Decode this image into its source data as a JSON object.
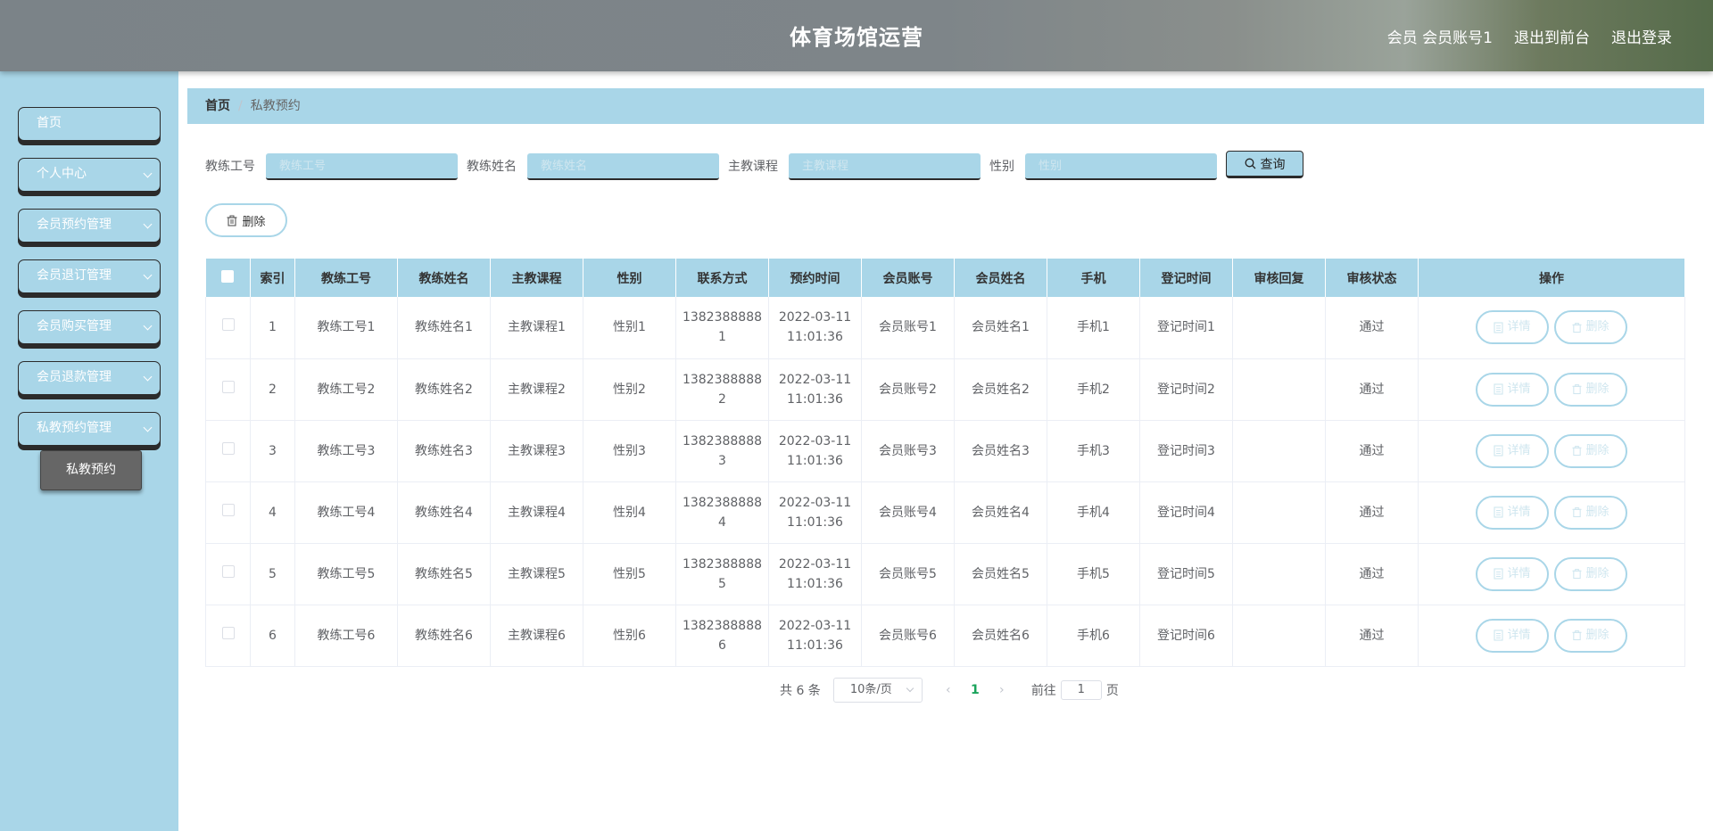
{
  "header": {
    "title": "体育场馆运营",
    "user": "会员 会员账号1",
    "front": "退出到前台",
    "logout": "退出登录"
  },
  "sidebar": {
    "items": [
      {
        "label": "首页"
      },
      {
        "label": "个人中心"
      },
      {
        "label": "会员预约管理"
      },
      {
        "label": "会员退订管理"
      },
      {
        "label": "会员购买管理"
      },
      {
        "label": "会员退款管理"
      },
      {
        "label": "私教预约管理"
      }
    ],
    "sub": "私教预约"
  },
  "breadcrumb": {
    "home": "首页",
    "sep": "/",
    "current": "私教预约"
  },
  "search": {
    "f1_label": "教练工号",
    "f1_placeholder": "教练工号",
    "f2_label": "教练姓名",
    "f2_placeholder": "教练姓名",
    "f3_label": "主教课程",
    "f3_placeholder": "主教课程",
    "f4_label": "性别",
    "f4_placeholder": "性别",
    "query": "查询"
  },
  "toolbar": {
    "delete": "删除"
  },
  "table": {
    "headers": [
      "索引",
      "教练工号",
      "教练姓名",
      "主教课程",
      "性别",
      "联系方式",
      "预约时间",
      "会员账号",
      "会员姓名",
      "手机",
      "登记时间",
      "审核回复",
      "审核状态",
      "操作"
    ],
    "detail": "详情",
    "delete": "删除",
    "rows": [
      {
        "idx": "1",
        "code": "教练工号1",
        "name": "教练姓名1",
        "course": "主教课程1",
        "gender": "性别1",
        "phone_a": "1382388888",
        "phone_b": "1",
        "date": "2022-03-11",
        "time": "11:01:36",
        "acct": "会员账号1",
        "mname": "会员姓名1",
        "mobile": "手机1",
        "reg": "登记时间1",
        "reply": "",
        "status": "通过"
      },
      {
        "idx": "2",
        "code": "教练工号2",
        "name": "教练姓名2",
        "course": "主教课程2",
        "gender": "性别2",
        "phone_a": "1382388888",
        "phone_b": "2",
        "date": "2022-03-11",
        "time": "11:01:36",
        "acct": "会员账号2",
        "mname": "会员姓名2",
        "mobile": "手机2",
        "reg": "登记时间2",
        "reply": "",
        "status": "通过"
      },
      {
        "idx": "3",
        "code": "教练工号3",
        "name": "教练姓名3",
        "course": "主教课程3",
        "gender": "性别3",
        "phone_a": "1382388888",
        "phone_b": "3",
        "date": "2022-03-11",
        "time": "11:01:36",
        "acct": "会员账号3",
        "mname": "会员姓名3",
        "mobile": "手机3",
        "reg": "登记时间3",
        "reply": "",
        "status": "通过"
      },
      {
        "idx": "4",
        "code": "教练工号4",
        "name": "教练姓名4",
        "course": "主教课程4",
        "gender": "性别4",
        "phone_a": "1382388888",
        "phone_b": "4",
        "date": "2022-03-11",
        "time": "11:01:36",
        "acct": "会员账号4",
        "mname": "会员姓名4",
        "mobile": "手机4",
        "reg": "登记时间4",
        "reply": "",
        "status": "通过"
      },
      {
        "idx": "5",
        "code": "教练工号5",
        "name": "教练姓名5",
        "course": "主教课程5",
        "gender": "性别5",
        "phone_a": "1382388888",
        "phone_b": "5",
        "date": "2022-03-11",
        "time": "11:01:36",
        "acct": "会员账号5",
        "mname": "会员姓名5",
        "mobile": "手机5",
        "reg": "登记时间5",
        "reply": "",
        "status": "通过"
      },
      {
        "idx": "6",
        "code": "教练工号6",
        "name": "教练姓名6",
        "course": "主教课程6",
        "gender": "性别6",
        "phone_a": "1382388888",
        "phone_b": "6",
        "date": "2022-03-11",
        "time": "11:01:36",
        "acct": "会员账号6",
        "mname": "会员姓名6",
        "mobile": "手机6",
        "reg": "登记时间6",
        "reply": "",
        "status": "通过"
      }
    ]
  },
  "pagination": {
    "total": "共 6 条",
    "size": "10条/页",
    "prev": "‹",
    "page": "1",
    "next": "›",
    "goto": "前往",
    "goto_value": "1",
    "unit": "页"
  },
  "colors": {
    "accent": "#a9d6e8",
    "header": "#7e8589",
    "active_page": "#1aa35b"
  }
}
